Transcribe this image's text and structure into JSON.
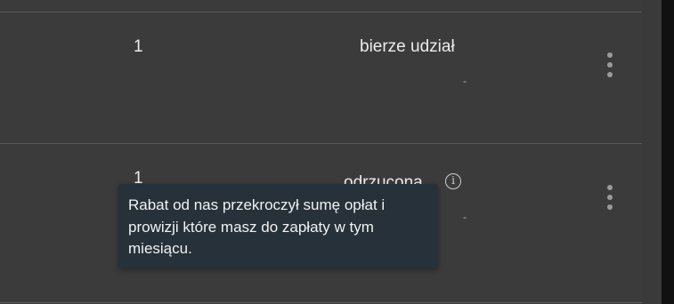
{
  "rows": [
    {
      "quantity": "1",
      "status": "bierze udział",
      "detail": "-",
      "has_info": false
    },
    {
      "quantity": "1",
      "status": "odrzucona",
      "detail": "-",
      "has_info": true
    }
  ],
  "tooltip": {
    "text": "Rabat od nas przekroczył sumę opłat i prowizji które masz do zapłaty w tym miesiącu."
  },
  "icons": {
    "info": "info-icon",
    "menu": "kebab-menu-icon"
  },
  "colors": {
    "background": "#3b3b3b",
    "tooltip_background": "#26313a",
    "divider": "#5a5a5a"
  }
}
